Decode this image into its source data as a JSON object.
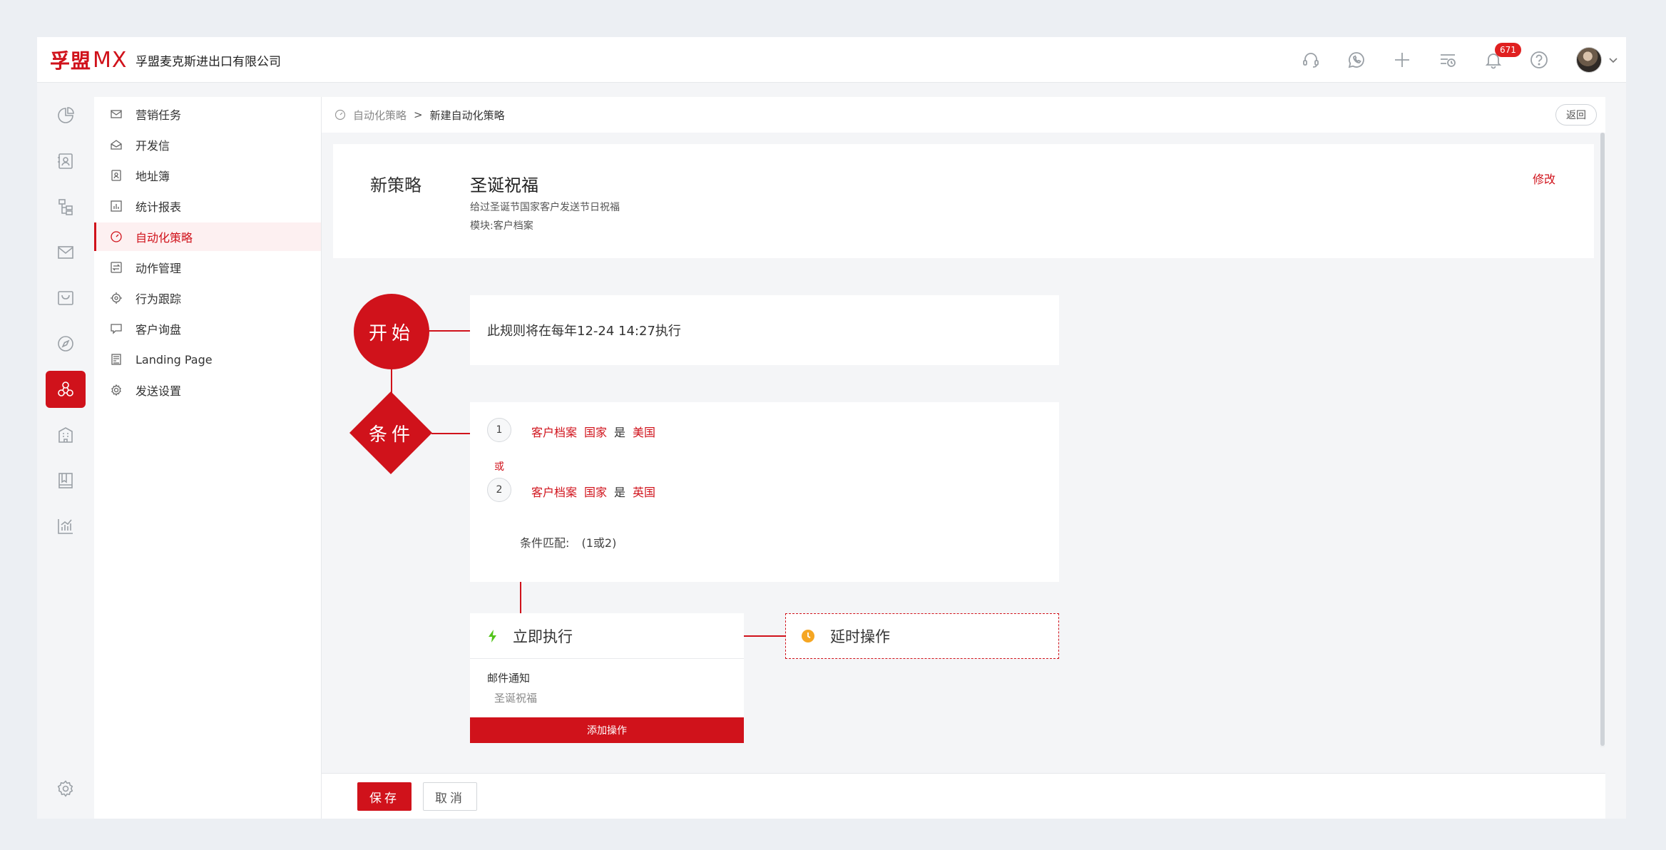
{
  "header": {
    "logo_cn": "孚盟",
    "logo_mx": "MX",
    "company": "孚盟麦克斯进出口有限公司",
    "icons": [
      "headset-icon",
      "whatsapp-icon",
      "plus-icon",
      "schedule-icon",
      "bell-icon",
      "help-icon"
    ],
    "notification_count": "671"
  },
  "rail": {
    "icons": [
      "pie-chart-icon",
      "contacts-icon",
      "org-tree-icon",
      "mail-icon",
      "inbox-icon",
      "compass-icon",
      "automation-icon",
      "building-icon",
      "catalog-icon",
      "analytics-icon",
      "settings-icon"
    ]
  },
  "sidebar": {
    "items": [
      {
        "label": "营销任务",
        "icon": "mail-icon"
      },
      {
        "label": "开发信",
        "icon": "open-mail-icon"
      },
      {
        "label": "地址簿",
        "icon": "address-book-icon"
      },
      {
        "label": "统计报表",
        "icon": "report-icon"
      },
      {
        "label": "自动化策略",
        "icon": "gauge-icon"
      },
      {
        "label": "动作管理",
        "icon": "action-icon"
      },
      {
        "label": "行为跟踪",
        "icon": "target-icon"
      },
      {
        "label": "客户询盘",
        "icon": "chat-icon"
      },
      {
        "label": "Landing Page",
        "icon": "landing-page-icon"
      },
      {
        "label": "发送设置",
        "icon": "gear-icon"
      }
    ],
    "active_index": 4
  },
  "breadcrumb": {
    "parent": "自动化策略",
    "separator": ">",
    "current": "新建自动化策略",
    "back_label": "返回"
  },
  "strategy": {
    "label": "新策略",
    "name": "圣诞祝福",
    "description": "给过圣诞节国家客户发送节日祝福",
    "module": "模块:客户档案",
    "edit_label": "修改"
  },
  "flow": {
    "start_label": "开始",
    "rule_text": "此规则将在每年12-24 14:27执行",
    "condition_label": "条件",
    "conditions": [
      {
        "num": "1",
        "field_group": "客户档案",
        "field": "国家",
        "op": "是",
        "value": "美国"
      },
      {
        "num": "2",
        "field_group": "客户档案",
        "field": "国家",
        "op": "是",
        "value": "英国"
      }
    ],
    "or_label": "或",
    "match_label": "条件匹配:",
    "match_value": "(1或2)",
    "exec": {
      "title": "立即执行",
      "type": "邮件通知",
      "name": "圣诞祝福",
      "add_label": "添加操作"
    },
    "delay": {
      "title": "延时操作"
    }
  },
  "footer": {
    "save_label": "保存",
    "cancel_label": "取消"
  },
  "colors": {
    "brand": "#d0121b",
    "bolt": "#52c41a",
    "clock": "#f5a623"
  }
}
